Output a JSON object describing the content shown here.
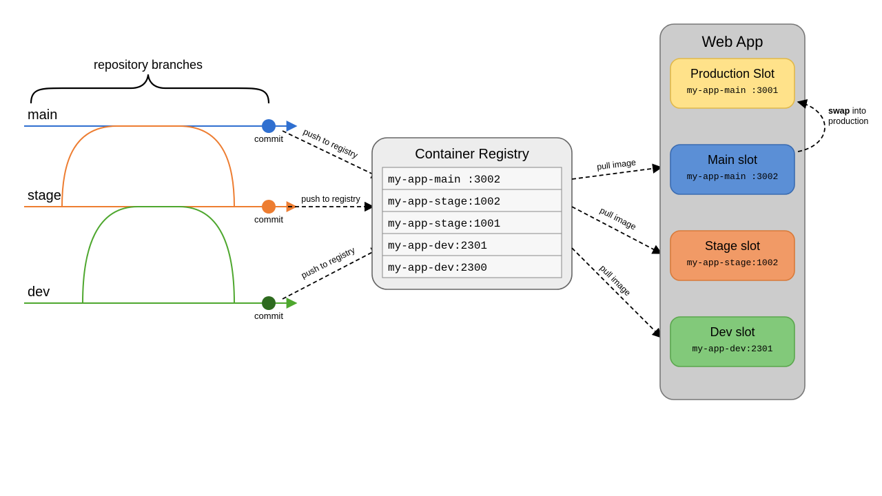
{
  "repo": {
    "label": "repository branches",
    "branches": {
      "main": {
        "name": "main",
        "color": "#2f6fd0",
        "commit_label": "commit",
        "edge": "push to registry"
      },
      "stage": {
        "name": "stage",
        "color": "#ed7d31",
        "commit_label": "commit",
        "edge": "push to registry"
      },
      "dev": {
        "name": "dev",
        "color": "#4ea72e",
        "commit_label": "commit",
        "edge": "push to registry"
      }
    }
  },
  "registry": {
    "title": "Container Registry",
    "images": [
      "my-app-main :3002",
      "my-app-stage:1002",
      "my-app-stage:1001",
      "my-app-dev:2301",
      "my-app-dev:2300"
    ]
  },
  "pull_labels": {
    "main": "pull image",
    "stage": "pull image",
    "dev": "pull image"
  },
  "webapp": {
    "title": "Web App",
    "slots": {
      "prod": {
        "title": "Production Slot",
        "image": "my-app-main :3001",
        "fill": "#ffe28a",
        "stroke": "#e0b84a"
      },
      "main": {
        "title": "Main slot",
        "image": "my-app-main :3002",
        "fill": "#5b8fd6",
        "stroke": "#3a6bb0"
      },
      "stage": {
        "title": "Stage slot",
        "image": "my-app-stage:1002",
        "fill": "#f19a66",
        "stroke": "#d87a3a"
      },
      "dev": {
        "title": "Dev slot",
        "image": "my-app-dev:2301",
        "fill": "#82c97a",
        "stroke": "#5aa64d"
      }
    },
    "swap_label_bold": "swap",
    "swap_label_rest": " into production"
  }
}
